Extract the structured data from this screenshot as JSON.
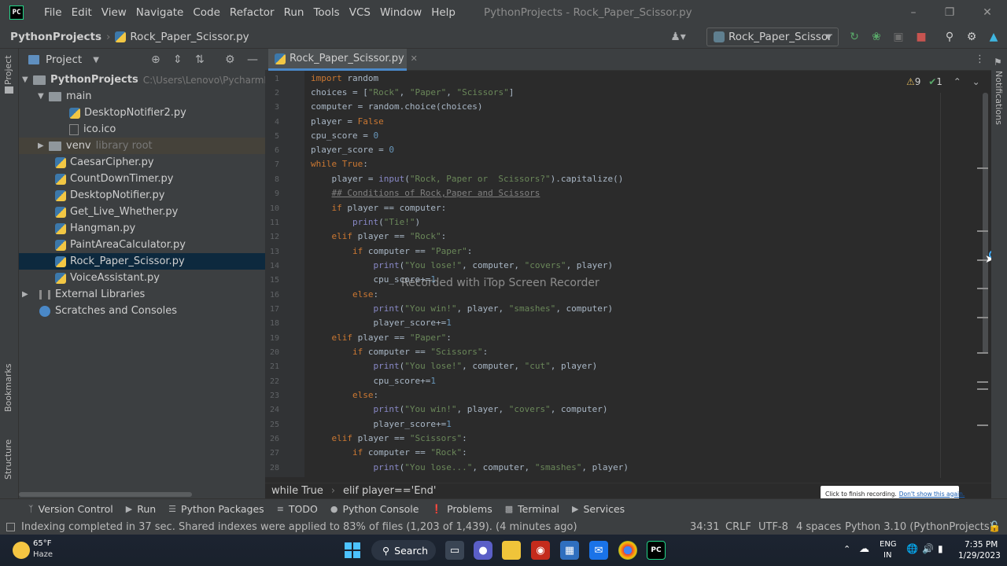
{
  "titlebar": {
    "logo": "PC",
    "menu": [
      "File",
      "Edit",
      "View",
      "Navigate",
      "Code",
      "Refactor",
      "Run",
      "Tools",
      "VCS",
      "Window",
      "Help"
    ],
    "window_title": "PythonProjects - Rock_Paper_Scissor.py"
  },
  "navbar": {
    "project": "PythonProjects",
    "file": "Rock_Paper_Scissor.py",
    "run_config": "Rock_Paper_Scissor"
  },
  "left_strip": {
    "project": "Project",
    "bookmarks": "Bookmarks",
    "structure": "Structure"
  },
  "project_panel": {
    "title": "Project",
    "tree": [
      {
        "label": "PythonProjects",
        "extra": "C:\\Users\\Lenovo\\PycharmPro",
        "kind": "root"
      },
      {
        "label": "main",
        "kind": "folder"
      },
      {
        "label": "DesktopNotifier2.py",
        "kind": "py"
      },
      {
        "label": "ico.ico",
        "kind": "ico"
      },
      {
        "label": "venv",
        "extra": "library root",
        "kind": "venv"
      },
      {
        "label": "CaesarCipher.py",
        "kind": "py"
      },
      {
        "label": "CountDownTimer.py",
        "kind": "py"
      },
      {
        "label": "DesktopNotifier.py",
        "kind": "py"
      },
      {
        "label": "Get_Live_Whether.py",
        "kind": "py"
      },
      {
        "label": "Hangman.py",
        "kind": "py"
      },
      {
        "label": "PaintAreaCalculator.py",
        "kind": "py"
      },
      {
        "label": "Rock_Paper_Scissor.py",
        "kind": "py",
        "selected": true
      },
      {
        "label": "VoiceAssistant.py",
        "kind": "py"
      },
      {
        "label": "External Libraries",
        "kind": "lib"
      },
      {
        "label": "Scratches and Consoles",
        "kind": "scratch"
      }
    ]
  },
  "editor": {
    "tab": "Rock_Paper_Scissor.py",
    "warnings": "9",
    "checks": "1",
    "lines": [
      "1",
      "2",
      "3",
      "4",
      "5",
      "6",
      "7",
      "8",
      "9",
      "10",
      "11",
      "12",
      "13",
      "14",
      "15",
      "16",
      "17",
      "18",
      "19",
      "20",
      "21",
      "22",
      "23",
      "24",
      "25",
      "26",
      "27",
      "28"
    ],
    "breadcrumbs": [
      "while True",
      "elif player=='End'"
    ]
  },
  "watermark": "Recorded with iTop Screen Recorder",
  "right_strip": {
    "notifications": "Notifications"
  },
  "toolwindows": [
    "Version Control",
    "Run",
    "Python Packages",
    "TODO",
    "Python Console",
    "Problems",
    "Terminal",
    "Services"
  ],
  "recording_tooltip": {
    "text": "Click to finish recording.",
    "link": "Don't show this again."
  },
  "status": {
    "message": "Indexing completed in 37 sec. Shared indexes were applied to 83% of files (1,203 of 1,439). (4 minutes ago)",
    "position": "34:31",
    "line_sep": "CRLF",
    "encoding": "UTF-8",
    "indent": "4 spaces",
    "interpreter": "Python 3.10 (PythonProjects)"
  },
  "taskbar": {
    "temp": "65°F",
    "weather": "Haze",
    "search": "Search",
    "lang1": "ENG",
    "lang2": "IN",
    "time": "7:35 PM",
    "date": "1/29/2023"
  }
}
